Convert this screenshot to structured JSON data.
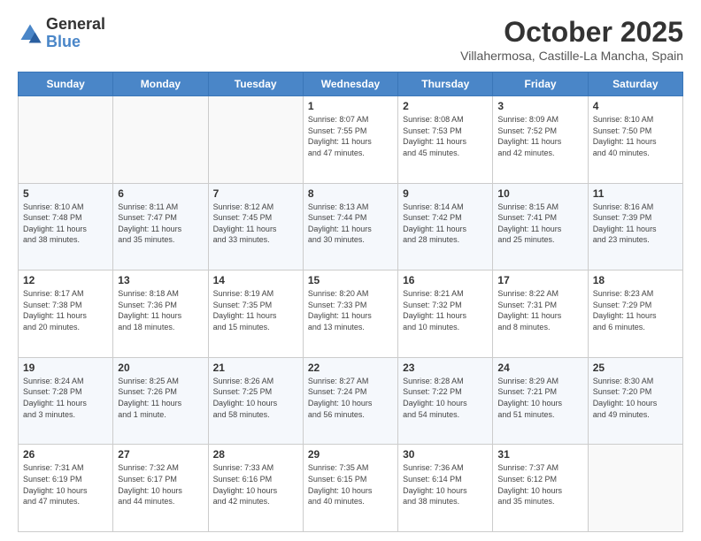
{
  "logo": {
    "general": "General",
    "blue": "Blue"
  },
  "header": {
    "month": "October 2025",
    "location": "Villahermosa, Castille-La Mancha, Spain"
  },
  "weekdays": [
    "Sunday",
    "Monday",
    "Tuesday",
    "Wednesday",
    "Thursday",
    "Friday",
    "Saturday"
  ],
  "rows": [
    [
      {
        "day": "",
        "info": ""
      },
      {
        "day": "",
        "info": ""
      },
      {
        "day": "",
        "info": ""
      },
      {
        "day": "1",
        "info": "Sunrise: 8:07 AM\nSunset: 7:55 PM\nDaylight: 11 hours\nand 47 minutes."
      },
      {
        "day": "2",
        "info": "Sunrise: 8:08 AM\nSunset: 7:53 PM\nDaylight: 11 hours\nand 45 minutes."
      },
      {
        "day": "3",
        "info": "Sunrise: 8:09 AM\nSunset: 7:52 PM\nDaylight: 11 hours\nand 42 minutes."
      },
      {
        "day": "4",
        "info": "Sunrise: 8:10 AM\nSunset: 7:50 PM\nDaylight: 11 hours\nand 40 minutes."
      }
    ],
    [
      {
        "day": "5",
        "info": "Sunrise: 8:10 AM\nSunset: 7:48 PM\nDaylight: 11 hours\nand 38 minutes."
      },
      {
        "day": "6",
        "info": "Sunrise: 8:11 AM\nSunset: 7:47 PM\nDaylight: 11 hours\nand 35 minutes."
      },
      {
        "day": "7",
        "info": "Sunrise: 8:12 AM\nSunset: 7:45 PM\nDaylight: 11 hours\nand 33 minutes."
      },
      {
        "day": "8",
        "info": "Sunrise: 8:13 AM\nSunset: 7:44 PM\nDaylight: 11 hours\nand 30 minutes."
      },
      {
        "day": "9",
        "info": "Sunrise: 8:14 AM\nSunset: 7:42 PM\nDaylight: 11 hours\nand 28 minutes."
      },
      {
        "day": "10",
        "info": "Sunrise: 8:15 AM\nSunset: 7:41 PM\nDaylight: 11 hours\nand 25 minutes."
      },
      {
        "day": "11",
        "info": "Sunrise: 8:16 AM\nSunset: 7:39 PM\nDaylight: 11 hours\nand 23 minutes."
      }
    ],
    [
      {
        "day": "12",
        "info": "Sunrise: 8:17 AM\nSunset: 7:38 PM\nDaylight: 11 hours\nand 20 minutes."
      },
      {
        "day": "13",
        "info": "Sunrise: 8:18 AM\nSunset: 7:36 PM\nDaylight: 11 hours\nand 18 minutes."
      },
      {
        "day": "14",
        "info": "Sunrise: 8:19 AM\nSunset: 7:35 PM\nDaylight: 11 hours\nand 15 minutes."
      },
      {
        "day": "15",
        "info": "Sunrise: 8:20 AM\nSunset: 7:33 PM\nDaylight: 11 hours\nand 13 minutes."
      },
      {
        "day": "16",
        "info": "Sunrise: 8:21 AM\nSunset: 7:32 PM\nDaylight: 11 hours\nand 10 minutes."
      },
      {
        "day": "17",
        "info": "Sunrise: 8:22 AM\nSunset: 7:31 PM\nDaylight: 11 hours\nand 8 minutes."
      },
      {
        "day": "18",
        "info": "Sunrise: 8:23 AM\nSunset: 7:29 PM\nDaylight: 11 hours\nand 6 minutes."
      }
    ],
    [
      {
        "day": "19",
        "info": "Sunrise: 8:24 AM\nSunset: 7:28 PM\nDaylight: 11 hours\nand 3 minutes."
      },
      {
        "day": "20",
        "info": "Sunrise: 8:25 AM\nSunset: 7:26 PM\nDaylight: 11 hours\nand 1 minute."
      },
      {
        "day": "21",
        "info": "Sunrise: 8:26 AM\nSunset: 7:25 PM\nDaylight: 10 hours\nand 58 minutes."
      },
      {
        "day": "22",
        "info": "Sunrise: 8:27 AM\nSunset: 7:24 PM\nDaylight: 10 hours\nand 56 minutes."
      },
      {
        "day": "23",
        "info": "Sunrise: 8:28 AM\nSunset: 7:22 PM\nDaylight: 10 hours\nand 54 minutes."
      },
      {
        "day": "24",
        "info": "Sunrise: 8:29 AM\nSunset: 7:21 PM\nDaylight: 10 hours\nand 51 minutes."
      },
      {
        "day": "25",
        "info": "Sunrise: 8:30 AM\nSunset: 7:20 PM\nDaylight: 10 hours\nand 49 minutes."
      }
    ],
    [
      {
        "day": "26",
        "info": "Sunrise: 7:31 AM\nSunset: 6:19 PM\nDaylight: 10 hours\nand 47 minutes."
      },
      {
        "day": "27",
        "info": "Sunrise: 7:32 AM\nSunset: 6:17 PM\nDaylight: 10 hours\nand 44 minutes."
      },
      {
        "day": "28",
        "info": "Sunrise: 7:33 AM\nSunset: 6:16 PM\nDaylight: 10 hours\nand 42 minutes."
      },
      {
        "day": "29",
        "info": "Sunrise: 7:35 AM\nSunset: 6:15 PM\nDaylight: 10 hours\nand 40 minutes."
      },
      {
        "day": "30",
        "info": "Sunrise: 7:36 AM\nSunset: 6:14 PM\nDaylight: 10 hours\nand 38 minutes."
      },
      {
        "day": "31",
        "info": "Sunrise: 7:37 AM\nSunset: 6:12 PM\nDaylight: 10 hours\nand 35 minutes."
      },
      {
        "day": "",
        "info": ""
      }
    ]
  ]
}
